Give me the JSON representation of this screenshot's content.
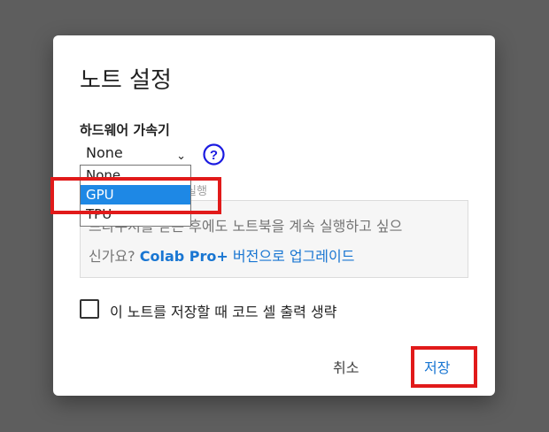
{
  "dialog": {
    "title": "노트 설정",
    "hardware_label": "하드웨어 가속기",
    "selected_accelerator": "None",
    "hidden_text_fragment": "실행",
    "info_line1": "브라우저를 닫은 후에도 노트북을 계속 실행하고 싶으",
    "info_line2_prefix": "신가요?",
    "info_line2_strong": "Colab Pro+",
    "info_line2_link": "버전으로 업그레이드",
    "checkbox_label": "이 노트를 저장할 때 코드 셀 출력 생략",
    "cancel_label": "취소",
    "save_label": "저장"
  },
  "dropdown": {
    "options": [
      "None",
      "GPU",
      "TPU"
    ],
    "highlighted": "GPU"
  },
  "colors": {
    "accent": "#1976d2",
    "highlight_box": "#e11a1a",
    "selected_option": "#1e88e5"
  }
}
